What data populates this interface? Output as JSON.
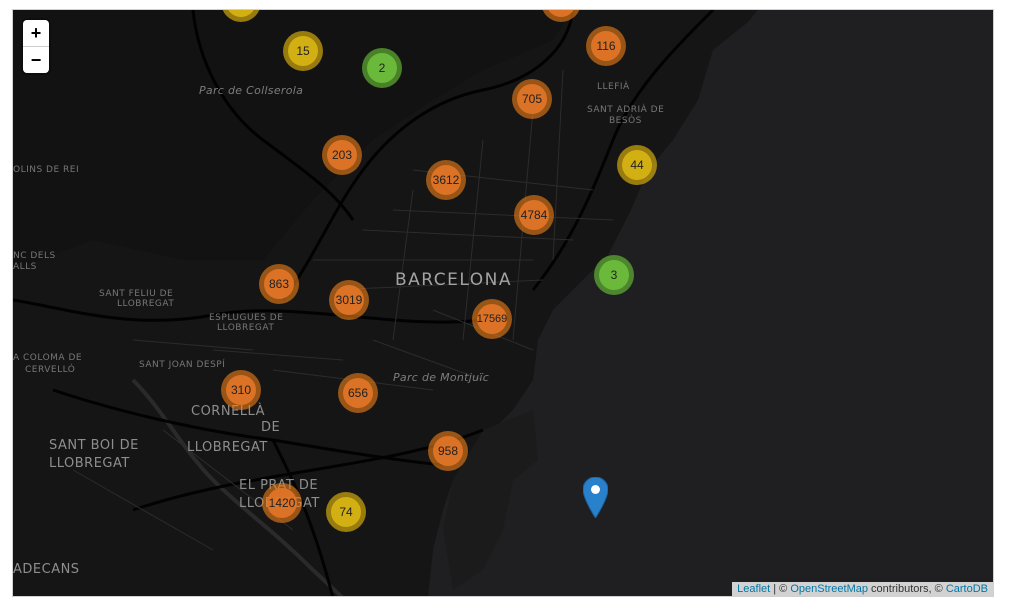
{
  "map": {
    "zoom_in_label": "+",
    "zoom_out_label": "−",
    "attribution": {
      "leaflet": "Leaflet",
      "sep1": " | © ",
      "osm": "OpenStreetMap",
      "contributors": " contributors, © ",
      "carto": "CartoDB"
    },
    "places": {
      "barcelona": "BARCELONA",
      "collserola": "Parc de Collserola",
      "montjuic": "Parc de Montjuïc",
      "cornella_1": "CORNELLÀ",
      "cornella_2": "DE",
      "cornella_3": "LLOBREGAT",
      "santboi_1": "SANT BOI DE",
      "santboi_2": "LLOBREGAT",
      "prat_1": "EL PRAT DE",
      "prat_2": "LLOBREGAT",
      "santfeliu_1": "SANT FELIU DE",
      "santfeliu_2": "LLOBREGAT",
      "esplugues_1": "ESPLUGUES DE",
      "esplugues_2": "LLOBREGAT",
      "santjoan": "SANT JOAN DESPÍ",
      "coloma_1": "A COLOMA DE",
      "coloma_2": "CERVELLÓ",
      "lliria": "LLEFIÀ",
      "santadria_1": "SANT ADRIÀ DE",
      "santadria_2": "BESÒS",
      "molins": "OLINS DE REI",
      "valls_1": "NC DELS",
      "valls_2": "ALLS",
      "decans": "ADECANS"
    },
    "clusters": [
      {
        "count": "15",
        "color": "yellow"
      },
      {
        "count": "2",
        "color": "green"
      },
      {
        "count": "116",
        "color": "orange"
      },
      {
        "count": "705",
        "color": "orange"
      },
      {
        "count": "203",
        "color": "orange"
      },
      {
        "count": "3612",
        "color": "orange"
      },
      {
        "count": "44",
        "color": "yellow"
      },
      {
        "count": "4784",
        "color": "orange"
      },
      {
        "count": "3",
        "color": "green"
      },
      {
        "count": "863",
        "color": "orange"
      },
      {
        "count": "3019",
        "color": "orange"
      },
      {
        "count": "17569",
        "color": "orange"
      },
      {
        "count": "310",
        "color": "orange"
      },
      {
        "count": "656",
        "color": "orange"
      },
      {
        "count": "958",
        "color": "orange"
      },
      {
        "count": "1420",
        "color": "orange"
      },
      {
        "count": "74",
        "color": "yellow"
      }
    ]
  }
}
